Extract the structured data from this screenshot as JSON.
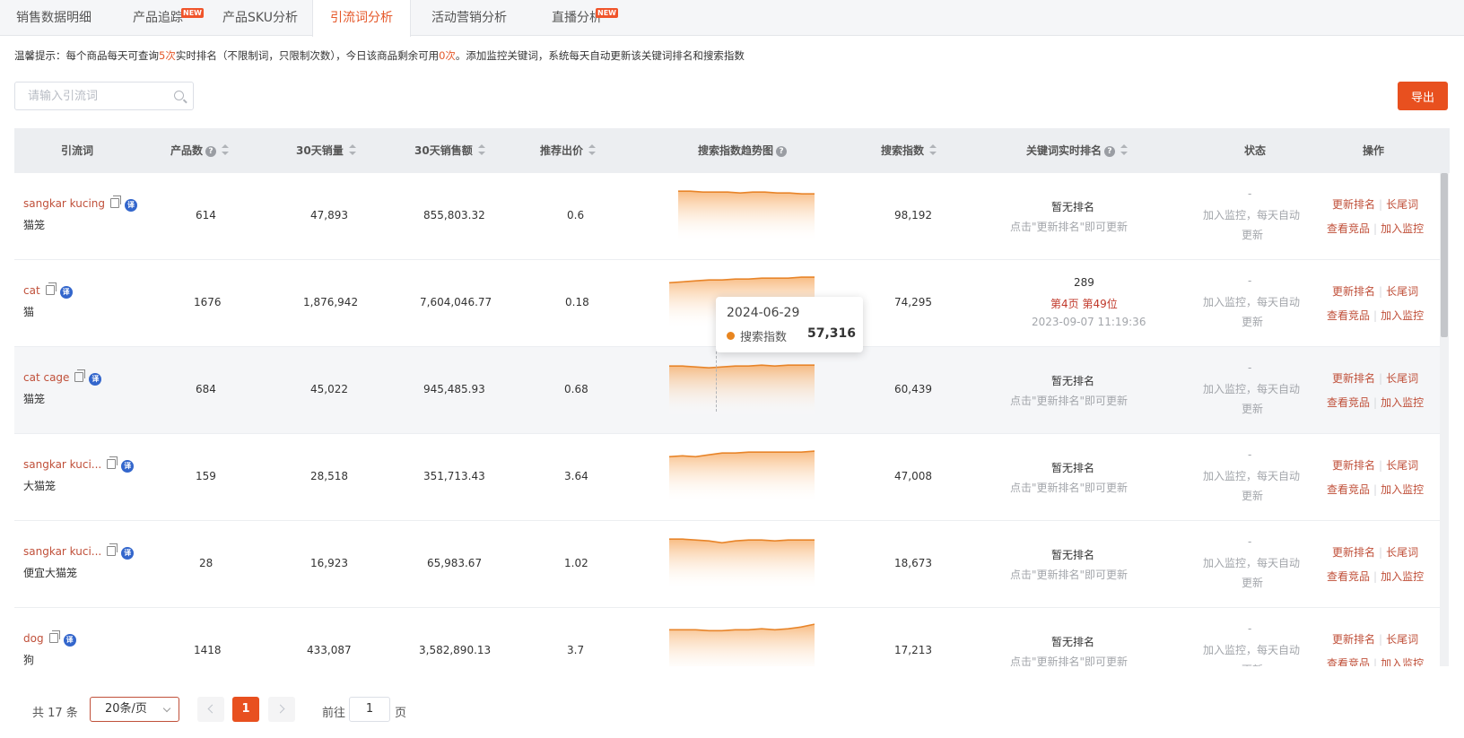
{
  "tabs": [
    {
      "label": "销售数据明细",
      "badge": ""
    },
    {
      "label": "产品追踪",
      "badge": "NEW"
    },
    {
      "label": "产品SKU分析",
      "badge": ""
    },
    {
      "label": "引流词分析",
      "badge": "",
      "active": true
    },
    {
      "label": "活动营销分析",
      "badge": ""
    },
    {
      "label": "直播分析",
      "badge": "NEW"
    }
  ],
  "tip": {
    "prefix": "温馨提示：每个商品每天可查询",
    "count1": "5次",
    "mid": "实时排名（不限制词，只限制次数），今日该商品剩余可用",
    "count2": "0次",
    "suffix": "。添加监控关键词，系统每天自动更新该关键词排名和搜索指数"
  },
  "search": {
    "placeholder": "请输入引流词"
  },
  "export_label": "导出",
  "columns": {
    "keyword": "引流词",
    "products": "产品数",
    "sales30": "30天销量",
    "revenue30": "30天销售额",
    "bid": "推荐出价",
    "trend": "搜索指数趋势图",
    "index": "搜索指数",
    "rank": "关键词实时排名",
    "status": "状态",
    "ops": "操作"
  },
  "rows": [
    {
      "keyword": "sangkar kucing",
      "zh": "猫笼",
      "products": "614",
      "sales": "47,893",
      "revenue": "855,803.32",
      "bid": "0.6",
      "index": "98,192",
      "rank_main": "暂无排名",
      "rank_page": "",
      "rank_pos": "",
      "rank_sub": "点击\"更新排名\"即可更新",
      "status_dash": "-",
      "status1": "加入监控，每天自动",
      "status2": "更新",
      "trend": [
        0.93,
        0.93,
        0.92,
        0.92,
        0.92,
        0.91,
        0.92,
        0.92,
        0.91,
        0.91,
        0.9,
        0.9
      ]
    },
    {
      "keyword": "cat",
      "zh": "猫",
      "products": "1676",
      "sales": "1,876,942",
      "revenue": "7,604,046.77",
      "bid": "0.18",
      "index": "74,295",
      "rank_main": "289",
      "rank_page": "第4页",
      "rank_pos": "第49位",
      "rank_sub": "2023-09-07 11:19:36",
      "status_dash": "-",
      "status1": "加入监控，每天自动",
      "status2": "更新",
      "trend": [
        0.88,
        0.89,
        0.9,
        0.91,
        0.91,
        0.92,
        0.92,
        0.93,
        0.93,
        0.93,
        0.94,
        0.94
      ]
    },
    {
      "keyword": "cat cage",
      "zh": "猫笼",
      "products": "684",
      "sales": "45,022",
      "revenue": "945,485.93",
      "bid": "0.68",
      "index": "60,439",
      "rank_main": "暂无排名",
      "rank_page": "",
      "rank_pos": "",
      "rank_sub": "点击\"更新排名\"即可更新",
      "status_dash": "-",
      "status1": "加入监控，每天自动",
      "status2": "更新",
      "trend": [
        0.92,
        0.92,
        0.91,
        0.9,
        0.91,
        0.92,
        0.92,
        0.93,
        0.92,
        0.93,
        0.93,
        0.93
      ]
    },
    {
      "keyword": "sangkar kuci...",
      "zh": "大猫笼",
      "products": "159",
      "sales": "28,518",
      "revenue": "351,713.43",
      "bid": "3.64",
      "index": "47,008",
      "rank_main": "暂无排名",
      "rank_page": "",
      "rank_pos": "",
      "rank_sub": "点击\"更新排名\"即可更新",
      "status_dash": "-",
      "status1": "加入监控，每天自动",
      "status2": "更新",
      "trend": [
        0.88,
        0.89,
        0.88,
        0.9,
        0.92,
        0.92,
        0.93,
        0.93,
        0.93,
        0.93,
        0.93,
        0.94
      ]
    },
    {
      "keyword": "sangkar kuci...",
      "zh": "便宜大猫笼",
      "products": "28",
      "sales": "16,923",
      "revenue": "65,983.67",
      "bid": "1.02",
      "index": "18,673",
      "rank_main": "暂无排名",
      "rank_page": "",
      "rank_pos": "",
      "rank_sub": "点击\"更新排名\"即可更新",
      "status_dash": "-",
      "status1": "加入监控，每天自动",
      "status2": "更新",
      "trend": [
        0.93,
        0.93,
        0.92,
        0.91,
        0.89,
        0.91,
        0.92,
        0.92,
        0.91,
        0.92,
        0.92,
        0.92
      ]
    },
    {
      "keyword": "dog",
      "zh": "狗",
      "products": "1418",
      "sales": "433,087",
      "revenue": "3,582,890.13",
      "bid": "3.7",
      "index": "17,213",
      "rank_main": "暂无排名",
      "rank_page": "",
      "rank_pos": "",
      "rank_sub": "点击\"更新排名\"即可更新",
      "status_dash": "-",
      "status1": "加入监控，每天自动",
      "status2": "更新",
      "trend": [
        0.89,
        0.89,
        0.89,
        0.88,
        0.88,
        0.89,
        0.89,
        0.9,
        0.89,
        0.9,
        0.92,
        0.95
      ]
    }
  ],
  "ops": {
    "update": "更新排名",
    "longtail": "长尾词",
    "view": "查看竞品",
    "monitor": "加入监控"
  },
  "tooltip": {
    "date": "2024-06-29",
    "name": "搜索指数",
    "value": "57,316"
  },
  "pagination": {
    "total": "共 17 条",
    "page_size": "20条/页",
    "current": "1",
    "goto": "前往",
    "goto_value": "1",
    "page_unit": "页"
  },
  "colors": {
    "accent": "#e8501f",
    "trend_line": "#e8852a",
    "link": "#c0503a"
  }
}
